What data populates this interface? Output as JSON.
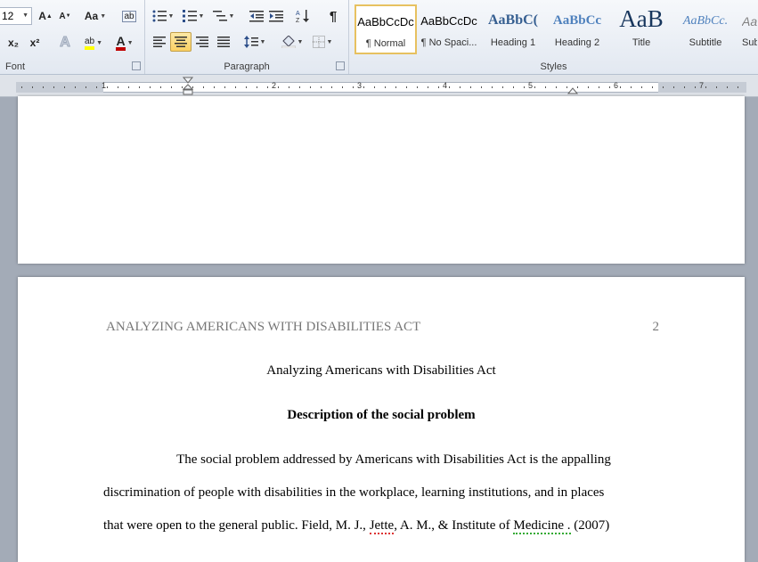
{
  "ribbon": {
    "font_group": {
      "label": "Font",
      "size": "12"
    },
    "paragraph_group": {
      "label": "Paragraph"
    },
    "styles_group": {
      "label": "Styles",
      "items": [
        {
          "sample": "AaBbCcDc",
          "name": "¶ Normal"
        },
        {
          "sample": "AaBbCcDc",
          "name": "¶ No Spaci..."
        },
        {
          "sample": "AaBbC(",
          "name": "Heading 1"
        },
        {
          "sample": "AaBbCc",
          "name": "Heading 2"
        },
        {
          "sample": "AaB",
          "name": "Title"
        },
        {
          "sample": "AaBbCc.",
          "name": "Subtitle"
        },
        {
          "sample": "Aa",
          "name": "Sub"
        }
      ]
    },
    "glyphs": {
      "grow": "A",
      "shrink": "A",
      "case": "Aa",
      "clear": "ab",
      "subscript": "x₂",
      "superscript": "x²",
      "text_effects": "A",
      "highlight": "ab",
      "font_color": "A",
      "pilcrow": "¶"
    }
  },
  "ruler": {
    "numbers": [
      "1",
      "2",
      "3",
      "4",
      "5",
      "6",
      "7"
    ]
  },
  "document": {
    "running_head": "ANALYZING AMERICANS WITH DISABILITIES ACT",
    "page_number": "2",
    "title": "Analyzing Americans with Disabilities Act",
    "heading": "Description of the social problem",
    "line1": "The social problem addressed by Americans with Disabilities Act is the appalling",
    "line2": "discrimination of people with disabilities in the workplace, learning institutions, and in places",
    "line3_a": "that were open to the general public. Field, M. J., ",
    "line3_b": "Jette",
    "line3_c": ", A. M., & Institute of ",
    "line3_d": "Medicine .",
    "line3_e": "(2007)"
  },
  "colors": {
    "accent_selected": "#e7c160",
    "highlight": "#ffff00",
    "font_color": "#c00000",
    "heading_blue": "#1f497d"
  }
}
